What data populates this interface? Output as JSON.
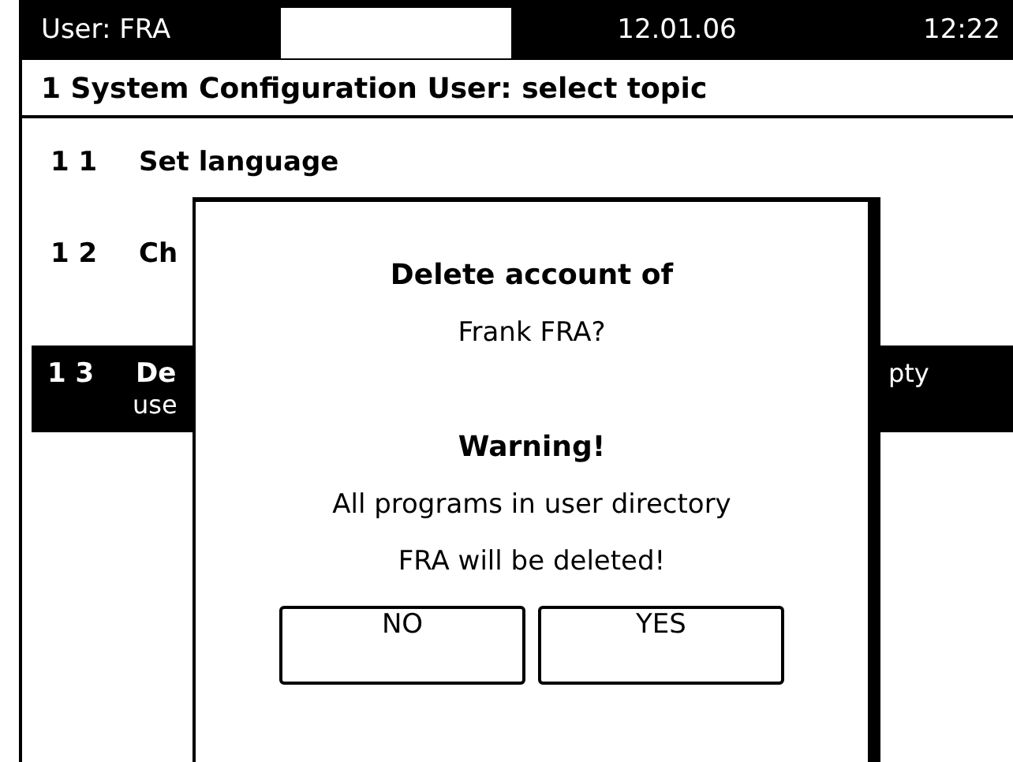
{
  "status_bar": {
    "user": "User:  FRA",
    "date": "12.01.06",
    "time": "12:22"
  },
  "header": {
    "title": "1 System Configuration User: select topic"
  },
  "menu": [
    {
      "number": "1 1",
      "label": "Set language",
      "selected": false
    },
    {
      "number": "1 2",
      "label": "Ch",
      "selected": false
    },
    {
      "number": "1 3",
      "label": "De",
      "label_right": "pty",
      "second_line": "use",
      "selected": true
    }
  ],
  "dialog": {
    "title": "Delete account of",
    "subject": "Frank FRA?",
    "warning_title": "Warning!",
    "warning_lines": [
      "All programs in user directory",
      "FRA will be deleted!"
    ],
    "buttons": [
      "NO",
      "YES"
    ]
  }
}
